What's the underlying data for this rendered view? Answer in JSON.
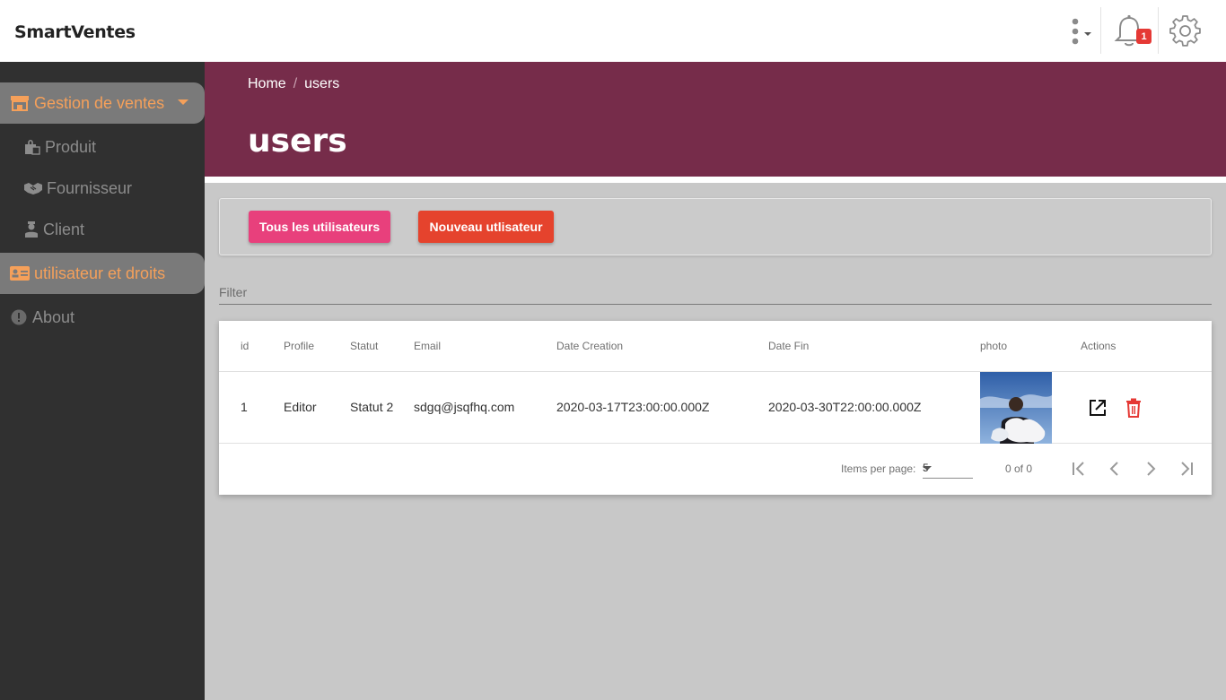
{
  "app": {
    "brand": "SmartVentes"
  },
  "topbar": {
    "notification_count": "1"
  },
  "sidebar": {
    "items": [
      {
        "label": "Gestion de ventes",
        "icon": "store-icon",
        "active": true
      },
      {
        "label": "Produit",
        "icon": "shopping-bag-icon"
      },
      {
        "label": "Fournisseur",
        "icon": "handshake-icon"
      },
      {
        "label": "Client",
        "icon": "person-icon"
      },
      {
        "label": "utilisateur et droits",
        "icon": "id-card-icon",
        "active": true
      },
      {
        "label": "About",
        "icon": "info-icon"
      }
    ]
  },
  "header": {
    "breadcrumb": {
      "home": "Home",
      "separator": "/",
      "current": "users"
    },
    "title": "users"
  },
  "actions": {
    "all_users": "Tous les utilisateurs",
    "new_user": "Nouveau utlisateur"
  },
  "filter": {
    "placeholder": "Filter"
  },
  "table": {
    "columns": [
      "id",
      "Profile",
      "Statut",
      "Email",
      "Date Creation",
      "Date Fin",
      "photo",
      "Actions"
    ],
    "rows": [
      {
        "id": "1",
        "profile": "Editor",
        "statut": "Statut 2",
        "email": "sdgq@jsqfhq.com",
        "date_creation": "2020-03-17T23:00:00.000Z",
        "date_fin": "2020-03-30T22:00:00.000Z"
      }
    ]
  },
  "paginator": {
    "items_per_page_label": "Items per page:",
    "page_size": "5",
    "range": "0 of 0"
  },
  "colors": {
    "header": "#762c4a",
    "sidebar": "#303030",
    "accent": "#f5a05a",
    "btn_all": "#e8407c",
    "btn_new": "#e5432d",
    "delete": "#e53935"
  }
}
